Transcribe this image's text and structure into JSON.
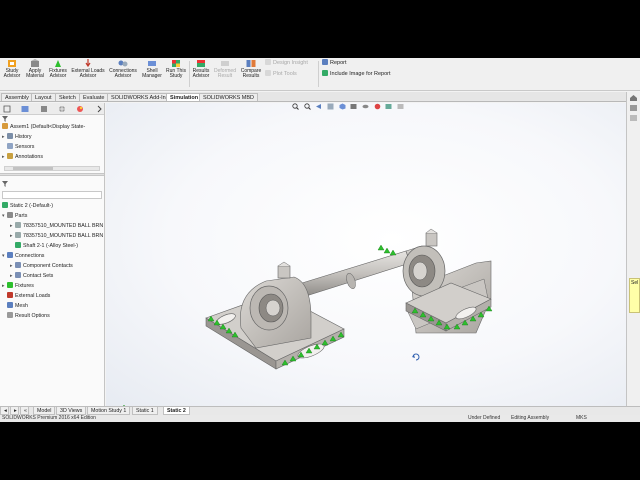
{
  "ribbon": {
    "buttons": [
      {
        "name": "study-advisor-button",
        "label": "Study\nAdvisor",
        "icon": "study-advisor-icon",
        "enabled": true
      },
      {
        "name": "apply-material-button",
        "label": "Apply\nMaterial",
        "icon": "apply-material-icon",
        "enabled": true
      },
      {
        "name": "fixtures-advisor-button",
        "label": "Fixtures\nAdvisor",
        "icon": "fixtures-advisor-icon",
        "enabled": true
      },
      {
        "name": "external-loads-advisor-button",
        "label": "External Loads\nAdvisor",
        "icon": "external-loads-icon",
        "enabled": true
      },
      {
        "name": "connections-advisor-button",
        "label": "Connections\nAdvisor",
        "icon": "connections-advisor-icon",
        "enabled": true
      },
      {
        "name": "shell-manager-button",
        "label": "Shell\nManager",
        "icon": "shell-manager-icon",
        "enabled": true
      },
      {
        "name": "run-this-study-button",
        "label": "Run This\nStudy",
        "icon": "run-study-icon",
        "enabled": true
      },
      {
        "name": "results-advisor-button",
        "label": "Results\nAdvisor",
        "icon": "results-advisor-icon",
        "enabled": true
      },
      {
        "name": "deformed-result-button",
        "label": "Deformed\nResult",
        "icon": "deformed-result-icon",
        "enabled": false
      },
      {
        "name": "compare-results-button",
        "label": "Compare\nResults",
        "icon": "compare-results-icon",
        "enabled": true
      }
    ],
    "small": {
      "design_insight": "Design Insight",
      "plot_tools": "Plot Tools",
      "report": "Report",
      "include_image": "Include Image for Report"
    }
  },
  "tabs": [
    "Assembly",
    "Layout",
    "Sketch",
    "Evaluate",
    "SOLIDWORKS Add-Ins",
    "Simulation",
    "SOLIDWORKS MBD"
  ],
  "active_tab": "Simulation",
  "feature_tree": {
    "root": "Assem1  (Default<Display State-",
    "items": [
      "History",
      "Sensors",
      "Annotations"
    ]
  },
  "sim_tree": {
    "root": "Static 2 (-Default-)",
    "parts_label": "Parts",
    "parts": [
      "78357510_MOUNTED BALL BRN",
      "78357510_MOUNTED BALL BRN",
      "Shaft 2-1 (-Alloy Steel-)"
    ],
    "connections_label": "Connections",
    "connections": [
      "Component Contacts",
      "Contact Sets"
    ],
    "fixtures": "Fixtures",
    "external_loads": "External Loads",
    "mesh": "Mesh",
    "result_options": "Result Options"
  },
  "task_note": "Sel",
  "bottom_tabs": [
    "Model",
    "3D Views",
    "Motion Study 1",
    "Static 1",
    "Static 2"
  ],
  "active_bottom_tab": "Static 2",
  "status": {
    "product": "SOLIDWORKS Premium 2016 x64 Edition",
    "defined": "Under Defined",
    "editing": "Editing Assembly",
    "units": "MKS"
  },
  "colors": {
    "fixture_green": "#2dbf2d",
    "part_gray": "#c9c6c2",
    "accent_red": "#c0392b"
  }
}
